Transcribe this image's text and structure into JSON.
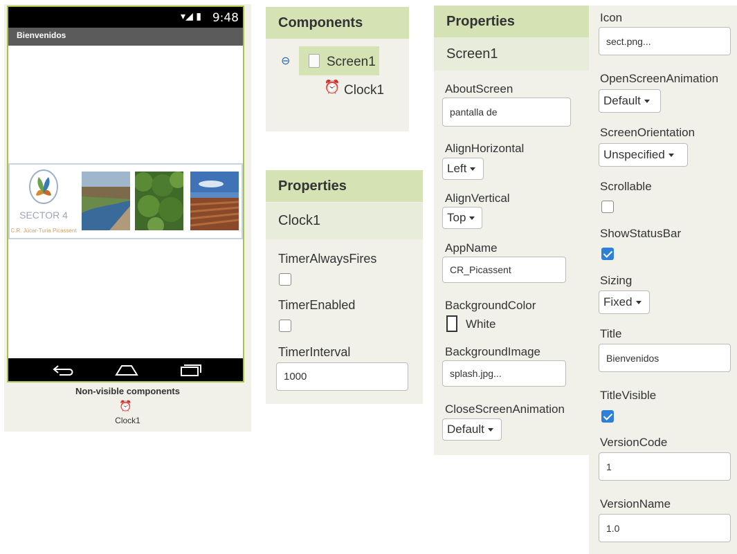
{
  "viewer": {
    "status_time": "9:48",
    "status_icons": "wifi-signal-battery",
    "screen_title": "Bienvenidos",
    "logo_text": "SECTOR 4",
    "logo_subtext": "C.R. Júcar-Turia Picassent",
    "non_visible_title": "Non-visible components",
    "non_visible_items": [
      "Clock1"
    ]
  },
  "components": {
    "header": "Components",
    "tree": [
      {
        "label": "Screen1",
        "icon": "screen-icon",
        "selected": true
      },
      {
        "label": "Clock1",
        "icon": "clock-icon"
      }
    ]
  },
  "clock_props": {
    "header": "Properties",
    "component": "Clock1",
    "timer_always_fires": {
      "label": "TimerAlwaysFires",
      "checked": false
    },
    "timer_enabled": {
      "label": "TimerEnabled",
      "checked": false
    },
    "timer_interval": {
      "label": "TimerInterval",
      "value": "1000"
    }
  },
  "screen_props": {
    "header": "Properties",
    "component": "Screen1",
    "about_screen": {
      "label": "AboutScreen",
      "value": "pantalla de"
    },
    "align_horizontal": {
      "label": "AlignHorizontal",
      "value": "Left"
    },
    "align_vertical": {
      "label": "AlignVertical",
      "value": "Top"
    },
    "app_name": {
      "label": "AppName",
      "value": "CR_Picassent"
    },
    "background_color": {
      "label": "BackgroundColor",
      "value": "White"
    },
    "background_image": {
      "label": "BackgroundImage",
      "value": "splash.jpg..."
    },
    "close_screen_animation": {
      "label": "CloseScreenAnimation",
      "value": "Default"
    },
    "icon": {
      "label": "Icon",
      "value": "sect.png..."
    },
    "open_screen_animation": {
      "label": "OpenScreenAnimation",
      "value": "Default"
    },
    "screen_orientation": {
      "label": "ScreenOrientation",
      "value": "Unspecified"
    },
    "scrollable": {
      "label": "Scrollable",
      "checked": false
    },
    "show_status_bar": {
      "label": "ShowStatusBar",
      "checked": true
    },
    "sizing": {
      "label": "Sizing",
      "value": "Fixed"
    },
    "title": {
      "label": "Title",
      "value": "Bienvenidos"
    },
    "title_visible": {
      "label": "TitleVisible",
      "checked": true
    },
    "version_code": {
      "label": "VersionCode",
      "value": "1"
    },
    "version_name": {
      "label": "VersionName",
      "value": "1.0"
    }
  },
  "colors": {
    "panel_bg": "#f1f1ea",
    "header_green": "#d5e2b4",
    "phone_border": "#a8c24a",
    "checkbox_blue": "#2d7fd8"
  }
}
